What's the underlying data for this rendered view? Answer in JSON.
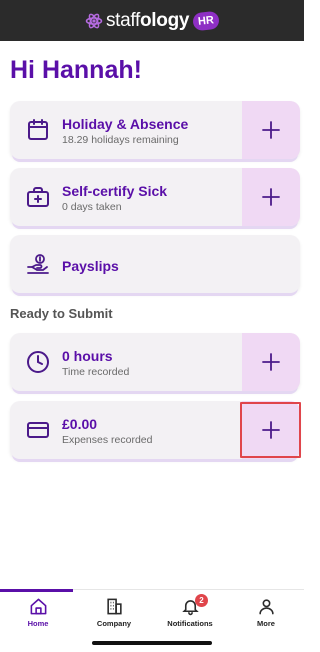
{
  "header": {
    "logo_text_light": "staff",
    "logo_text_bold": "ology",
    "logo_badge": "HR"
  },
  "greeting": "Hi Hannah!",
  "cards": [
    {
      "title": "Holiday & Absence",
      "subtitle": "18.29 holidays remaining",
      "icon": "calendar-icon",
      "has_add": true
    },
    {
      "title": "Self-certify Sick",
      "subtitle": "0 days taken",
      "icon": "medical-kit-icon",
      "has_add": true
    },
    {
      "title": "Payslips",
      "subtitle": "",
      "icon": "hand-money-icon",
      "has_add": false
    }
  ],
  "ready_section": {
    "title": "Ready to Submit",
    "cards": [
      {
        "title": "0 hours",
        "subtitle": "Time recorded",
        "icon": "clock-icon",
        "has_add": true
      },
      {
        "title": "£0.00",
        "subtitle": "Expenses recorded",
        "icon": "credit-card-icon",
        "has_add": true
      }
    ]
  },
  "tabs": [
    {
      "label": "Home",
      "icon": "home-icon",
      "active": true
    },
    {
      "label": "Company",
      "icon": "building-icon",
      "active": false
    },
    {
      "label": "Notifications",
      "icon": "bell-icon",
      "active": false,
      "badge": "2"
    },
    {
      "label": "More",
      "icon": "person-icon",
      "active": false
    }
  ],
  "colors": {
    "brand_purple": "#5a0fa8",
    "add_button_bg": "#f0d9f4",
    "card_bg": "#f3f1f4",
    "topbar_bg": "#2b2b2b",
    "highlight": "#e0454b"
  }
}
